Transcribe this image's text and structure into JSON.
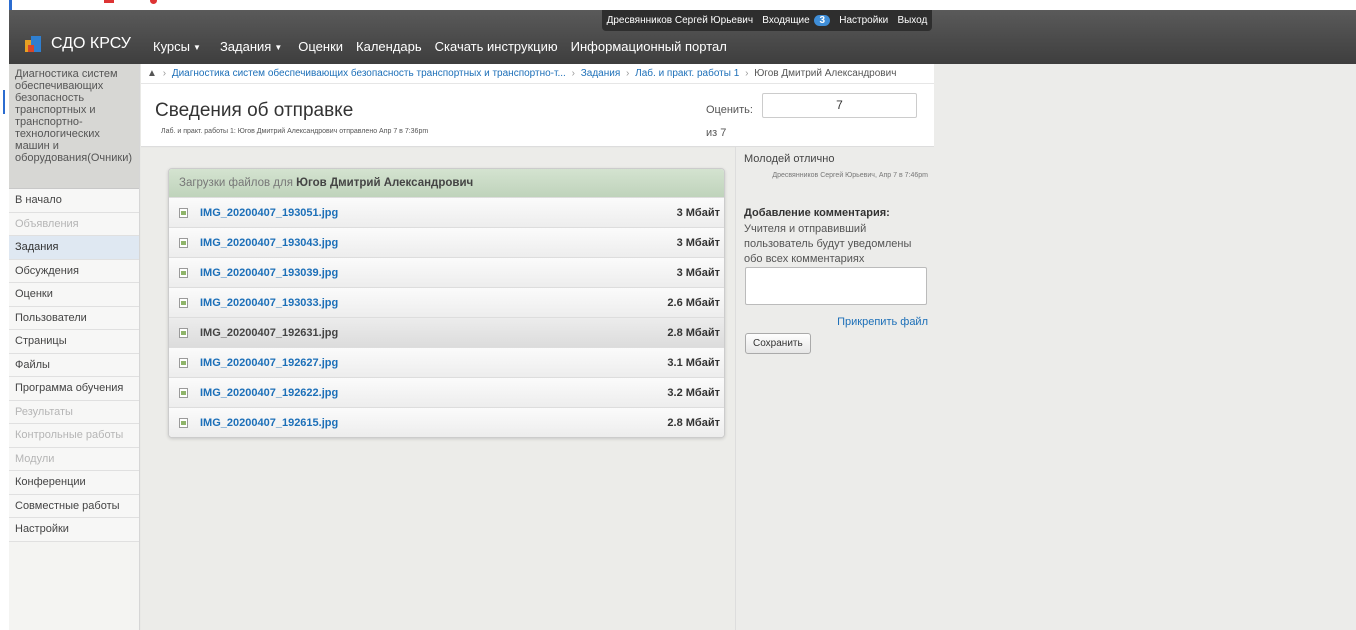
{
  "header": {
    "user_name": "Дресвянников Сергей Юрьевич",
    "inbox_label": "Входящие",
    "inbox_count": "3",
    "settings_label": "Настройки",
    "logout_label": "Выход",
    "logo_text": "СДО КРСУ",
    "nav": {
      "courses": "Курсы",
      "assignments": "Задания",
      "grades": "Оценки",
      "calendar": "Календарь",
      "download": "Скачать инструкцию",
      "portal": "Информационный портал"
    }
  },
  "sidebar": {
    "course_title": "Диагностика систем обеспечивающих безопасность транспортных и транспортно-технологических машин и оборудования(Очники)",
    "items": [
      {
        "label": "В начало"
      },
      {
        "label": "Объявления"
      },
      {
        "label": "Задания"
      },
      {
        "label": "Обсуждения"
      },
      {
        "label": "Оценки"
      },
      {
        "label": "Пользователи"
      },
      {
        "label": "Страницы"
      },
      {
        "label": "Файлы"
      },
      {
        "label": "Программа обучения"
      },
      {
        "label": "Результаты"
      },
      {
        "label": "Контрольные работы"
      },
      {
        "label": "Модули"
      },
      {
        "label": "Конференции"
      },
      {
        "label": "Совместные работы"
      },
      {
        "label": "Настройки"
      }
    ]
  },
  "breadcrumb": {
    "course": "Диагностика систем обеспечивающих безопасность транспортных и транспортно-т...",
    "assignments": "Задания",
    "assignment": "Лаб. и практ. работы 1",
    "student": "Югов Дмитрий Александрович"
  },
  "submission": {
    "title": "Сведения об отправке",
    "meta": "Лаб. и практ. работы 1: Югов Дмитрий Александрович   отправлено Апр 7 в 7:36pm",
    "grade_label": "Оценить:",
    "grade_value": "7",
    "grade_of": "из 7"
  },
  "files": {
    "header_prefix": "Загрузки файлов для",
    "header_student": "Югов Дмитрий Александрович",
    "rows": [
      {
        "name": "IMG_20200407_193051.jpg",
        "size": "3 Мбайт"
      },
      {
        "name": "IMG_20200407_193043.jpg",
        "size": "3 Мбайт"
      },
      {
        "name": "IMG_20200407_193039.jpg",
        "size": "3 Мбайт"
      },
      {
        "name": "IMG_20200407_193033.jpg",
        "size": "2.6 Мбайт"
      },
      {
        "name": "IMG_20200407_192631.jpg",
        "size": "2.8 Мбайт"
      },
      {
        "name": "IMG_20200407_192627.jpg",
        "size": "3.1 Мбайт"
      },
      {
        "name": "IMG_20200407_192622.jpg",
        "size": "3.2 Мбайт"
      },
      {
        "name": "IMG_20200407_192615.jpg",
        "size": "2.8 Мбайт"
      }
    ]
  },
  "comments": {
    "existing_text": "Молодей отлично",
    "existing_meta": "Дресвянников Сергей Юрьевич, Апр 7 в 7:46pm",
    "add_title": "Добавление комментария:",
    "add_note": "Учителя и отправивший пользователь будут уведомлены обо всех комментариях",
    "attach_label": "Прикрепить файл",
    "save_label": "Сохранить"
  }
}
